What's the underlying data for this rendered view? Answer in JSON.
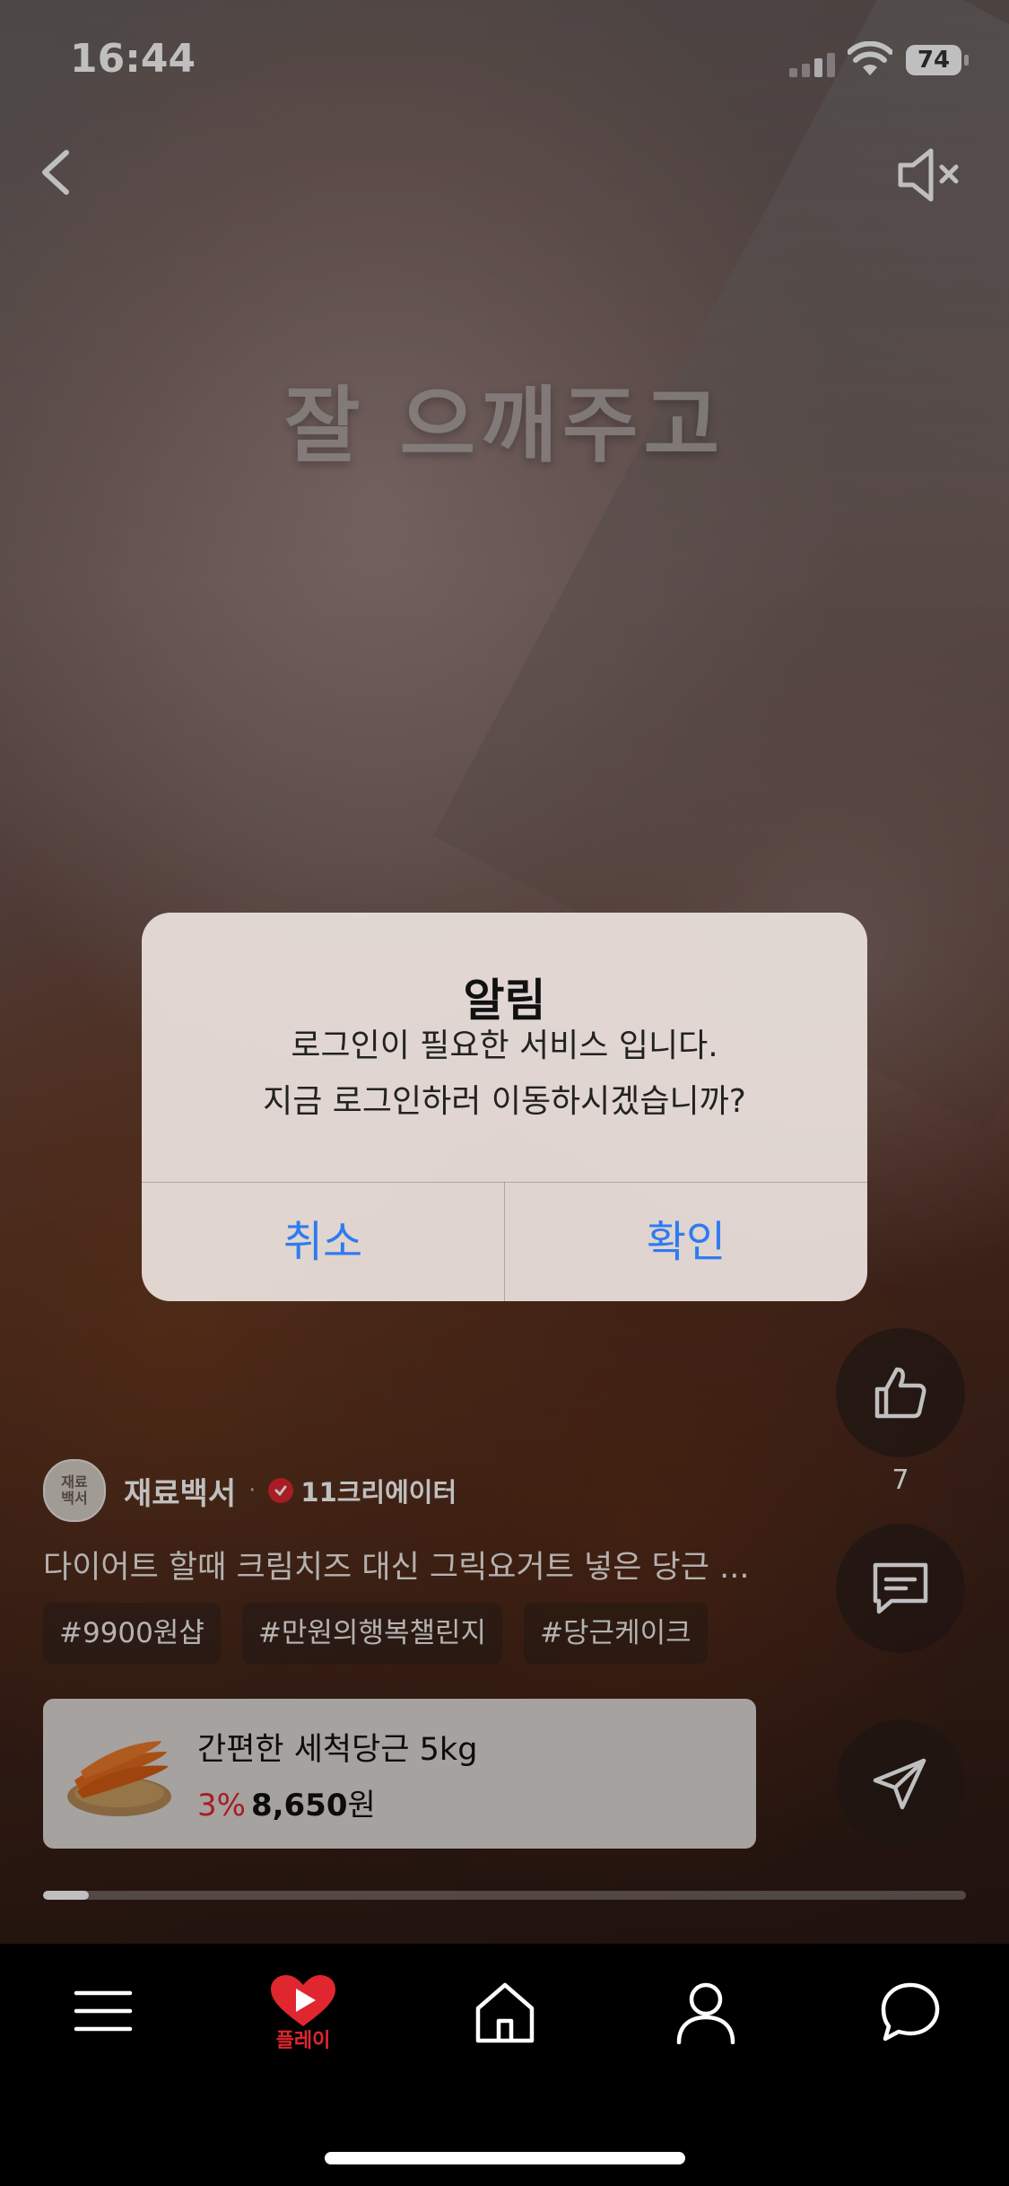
{
  "status_bar": {
    "time": "16:44",
    "battery": "74"
  },
  "video": {
    "caption": "잘 으깨주고"
  },
  "alert": {
    "title": "알림",
    "message_line1": "로그인이 필요한 서비스 입니다.",
    "message_line2": "지금 로그인하러 이동하시겠습니까?",
    "cancel_label": "취소",
    "confirm_label": "확인"
  },
  "actions": {
    "like_count": "7"
  },
  "creator": {
    "avatar_text": "재료\n백서",
    "name": "재료백서",
    "separator": "·",
    "badge": "11크리에이터"
  },
  "post": {
    "description": "다이어트 할때 크림치즈 대신 그릭요거트 넣은 당근 ...",
    "tags": [
      "#9900원샵",
      "#만원의행복챌린지",
      "#당근케이크"
    ]
  },
  "product": {
    "name": "간편한 세척당근 5kg",
    "discount": "3%",
    "price": "8,650",
    "currency": "원"
  },
  "playback": {
    "progress": 0.05
  },
  "nav": {
    "play_label": "플레이"
  },
  "colors": {
    "accent": "#e0262f",
    "alert_button": "#2f7bf1"
  }
}
